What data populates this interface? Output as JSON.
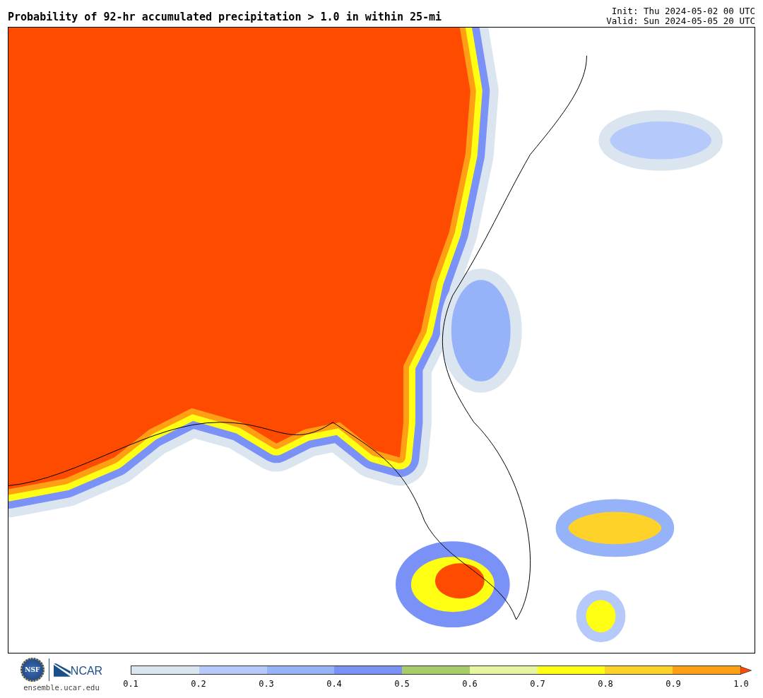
{
  "title": "Probability of 92-hr accumulated precipitation > 1.0 in within 25-mi",
  "init": "Init: Thu 2024-05-02 00 UTC",
  "valid": "Valid: Sun 2024-05-05 20 UTC",
  "logos": {
    "nsf": "NSF",
    "ncar": "NCAR",
    "url": "ensemble.ucar.edu"
  },
  "colorbar": {
    "bins": [
      {
        "color": "#dbe5ef"
      },
      {
        "color": "#b5c9fa"
      },
      {
        "color": "#96b3fa"
      },
      {
        "color": "#7a91f8"
      },
      {
        "color": "#a8cc6a"
      },
      {
        "color": "#e6f5a2"
      },
      {
        "color": "#ffff14"
      },
      {
        "color": "#ffd22a"
      },
      {
        "color": "#ffa014"
      }
    ],
    "extension": {
      "color": "#ff4b00"
    },
    "ticks": [
      "0.1",
      "0.2",
      "0.3",
      "0.4",
      "0.5",
      "0.6",
      "0.7",
      "0.8",
      "0.9",
      "1.0"
    ]
  }
}
